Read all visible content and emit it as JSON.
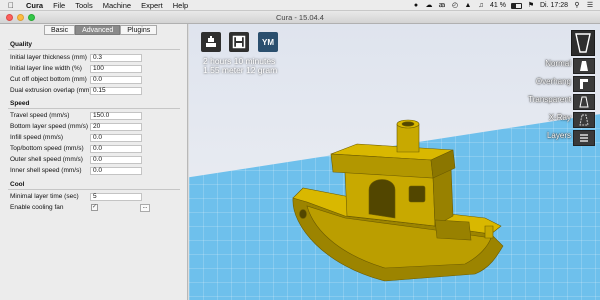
{
  "menubar": {
    "app": "Cura",
    "items": [
      "File",
      "Tools",
      "Machine",
      "Expert",
      "Help"
    ],
    "battery": "41 %",
    "battery_level": 0.41,
    "clock": "Di. 17:28"
  },
  "window": {
    "title": "Cura - 15.04.4"
  },
  "tabs": [
    "Basic",
    "Advanced",
    "Plugins"
  ],
  "active_tab": "Advanced",
  "sections": {
    "quality": {
      "title": "Quality",
      "rows": [
        {
          "label": "Initial layer thickness (mm)",
          "value": "0.3"
        },
        {
          "label": "Initial layer line width (%)",
          "value": "100"
        },
        {
          "label": "Cut off object bottom (mm)",
          "value": "0.0"
        },
        {
          "label": "Dual extrusion overlap (mm)",
          "value": "0.15"
        }
      ]
    },
    "speed": {
      "title": "Speed",
      "rows": [
        {
          "label": "Travel speed (mm/s)",
          "value": "150.0"
        },
        {
          "label": "Bottom layer speed (mm/s)",
          "value": "20"
        },
        {
          "label": "Infill speed (mm/s)",
          "value": "0.0"
        },
        {
          "label": "Top/bottom speed (mm/s)",
          "value": "0.0"
        },
        {
          "label": "Outer shell speed (mm/s)",
          "value": "0.0"
        },
        {
          "label": "Inner shell speed (mm/s)",
          "value": "0.0"
        }
      ]
    },
    "cool": {
      "title": "Cool",
      "min_layer_label": "Minimal layer time (sec)",
      "min_layer_value": "5",
      "fan_label": "Enable cooling fan",
      "fan_enabled": true,
      "more_button": "..."
    }
  },
  "viewport": {
    "print_time": "2 hours 10 minutes",
    "print_material": "1.55 meter 12 gram",
    "ym_label": "YM",
    "view_modes": [
      "Normal",
      "Overhang",
      "Transparent",
      "X-Ray",
      "Layers"
    ],
    "model_color": "#d9b800",
    "bed_color": "#6ec0ec"
  }
}
